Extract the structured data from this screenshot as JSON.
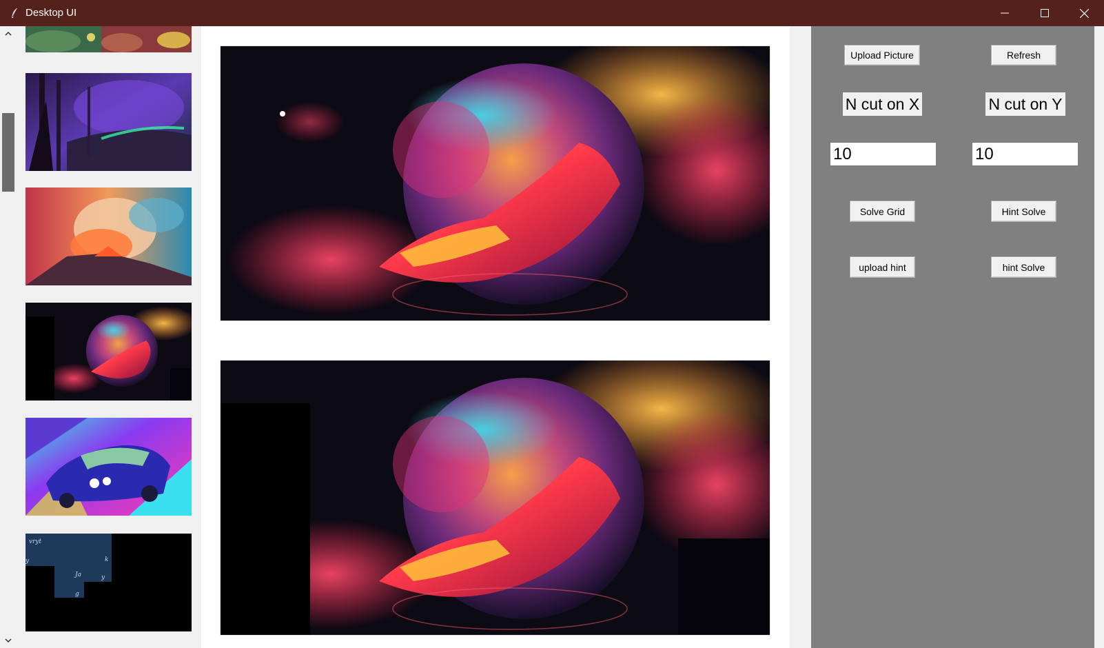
{
  "window": {
    "title": "Desktop UI",
    "title_color": "#54211b",
    "icons": [
      "feather-icon",
      "minimize-icon",
      "maximize-icon",
      "close-icon"
    ]
  },
  "thumbnails": {
    "scrollbar_icons": [
      "chevron-up-icon",
      "chevron-down-icon"
    ],
    "items": [
      "partial-colorful-thumbnail",
      "dark-forest-neon-thumbnail",
      "volcano-clouds-thumbnail",
      "nebula-planet-puzzle-thumbnail",
      "retro-car-thumbnail",
      "text-pattern-puzzle-thumbnail"
    ]
  },
  "main": {
    "images": [
      "original-nebula-image",
      "puzzle-nebula-image"
    ]
  },
  "controls": {
    "upload_picture": "Upload Picture",
    "refresh": "Refresh",
    "n_cut_x_label": "N cut on X",
    "n_cut_y_label": "N cut on Y",
    "n_cut_x_value": "10",
    "n_cut_y_value": "10",
    "solve_grid": "Solve Grid",
    "hint_solve": "Hint Solve",
    "upload_hint": "upload hint",
    "hint_solve_lower": "hint Solve",
    "panel_color": "#808080"
  }
}
